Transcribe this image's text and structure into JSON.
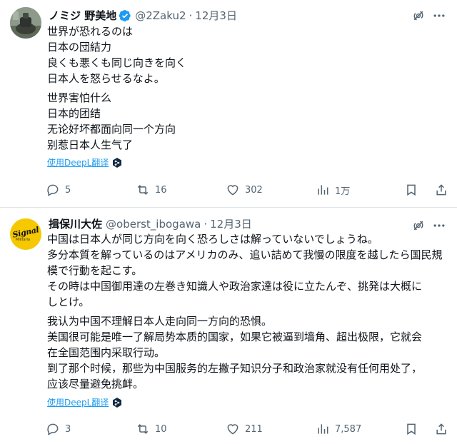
{
  "tweets": [
    {
      "name": "ノミジ 野美地",
      "handle": "@2Zaku2",
      "separator": "·",
      "date": "12月3日",
      "paragraphs": [
        [
          "世界が恐れるのは",
          "日本の団結力",
          "良くも悪くも同じ向きを向く",
          "日本人を怒らせるなよ。"
        ],
        [
          "世界害怕什么",
          "日本的团结",
          "无论好坏都面向同一个方向",
          "别惹日本人生气了"
        ]
      ],
      "translate_label": "使用DeepL翻译",
      "replies": "5",
      "retweets": "16",
      "likes": "302",
      "views": "1万"
    },
    {
      "name": "揖保川大佐",
      "handle": "@oberst_ibogawa",
      "separator": "·",
      "date": "12月3日",
      "avatar_text": "Signal",
      "avatar_subtext": "Militaria",
      "paragraphs": [
        [
          "中国は日本人が同じ方向を向く恐ろしさは解っていないでしょうね。",
          "多分本質を解っているのはアメリカのみ、追い詰めて我慢の限度を越したら国民規",
          "模で行動を起こす。",
          "その時は中国御用達の左巻き知識人や政治家達は役に立たんぞ、挑発は大概に",
          "しとけ。"
        ],
        [
          "我认为中国不理解日本人走向同一方向的恐惧。",
          "美国很可能是唯一了解局势本质的国家，如果它被逼到墙角、超出极限，它就会",
          "在全国范围内采取行动。",
          "到了那个时候，那些为中国服务的左撇子知识分子和政治家就没有任何用处了，",
          "应该尽量避免挑衅。"
        ]
      ],
      "translate_label": "使用DeepL翻译",
      "replies": "3",
      "retweets": "10",
      "likes": "211",
      "views": "7,587"
    }
  ],
  "colors": {
    "text": "#0f1419",
    "secondary": "#536471",
    "link": "#1d9bf0",
    "verified": "#1d9bf0",
    "divider": "#dfe3e6",
    "signal_yellow": "#f5c800"
  },
  "icons": [
    "verified-badge-icon",
    "grok-icon",
    "more-icon",
    "deepl-icon",
    "reply-icon",
    "retweet-icon",
    "like-icon",
    "views-icon",
    "bookmark-icon",
    "share-icon"
  ]
}
